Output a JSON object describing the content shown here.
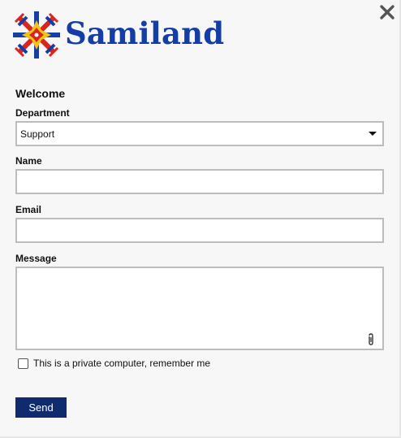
{
  "brand": {
    "name": "Samiland",
    "logo_icon": "samiland-star-logo",
    "colors": {
      "primary": "#153da6",
      "red": "#d9261c",
      "yellow": "#f2c216",
      "button": "#0f2b6e"
    }
  },
  "window": {
    "close_icon": "close-icon"
  },
  "form": {
    "welcome": "Welcome",
    "department": {
      "label": "Department",
      "selected": "Support"
    },
    "name": {
      "label": "Name",
      "value": ""
    },
    "email": {
      "label": "Email",
      "value": ""
    },
    "message": {
      "label": "Message",
      "value": "",
      "attachment_icon": "paperclip-icon"
    },
    "remember": {
      "label": "This is a private computer, remember me",
      "checked": false
    },
    "send_label": "Send"
  }
}
